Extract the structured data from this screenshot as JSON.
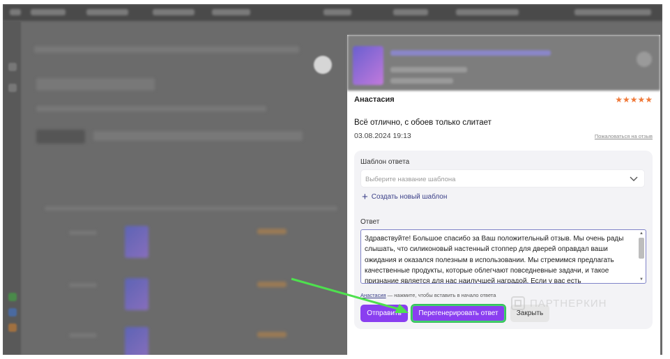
{
  "review": {
    "author": "Анастасия",
    "stars": "★★★★★",
    "text": "Всё отлично, с обоев только слитает",
    "date": "03.08.2024 19:13",
    "complain_link": "Пожаловаться на отзыв"
  },
  "reply": {
    "template_label": "Шаблон ответа",
    "template_placeholder": "Выберите название шаблона",
    "create_template": "Создать новый шаблон",
    "answer_label": "Ответ",
    "answer_text": "Здравствуйте! Большое спасибо за Ваш положительный отзыв. Мы очень рады слышать, что силиконовый настенный стоппер для дверей оправдал ваши ожидания и оказался полезным в использовании. Мы стремимся предлагать качественные продукты, которые облегчают повседневные задачи, и такое признание является для нас наилучшей наградой. Если у вас есть дополнительные",
    "hint_name": "Анастасия",
    "hint_rest": " — нажмите, чтобы вставить в начало ответа"
  },
  "buttons": {
    "send": "Отправить",
    "regenerate": "Перегенерировать ответ",
    "close": "Закрыть"
  },
  "watermark": "ПАРТНЕРКИН",
  "colors": {
    "accent": "#8a3ff0",
    "highlight": "#40d46a",
    "stars": "#f07a3a",
    "link": "#3a3f88"
  }
}
